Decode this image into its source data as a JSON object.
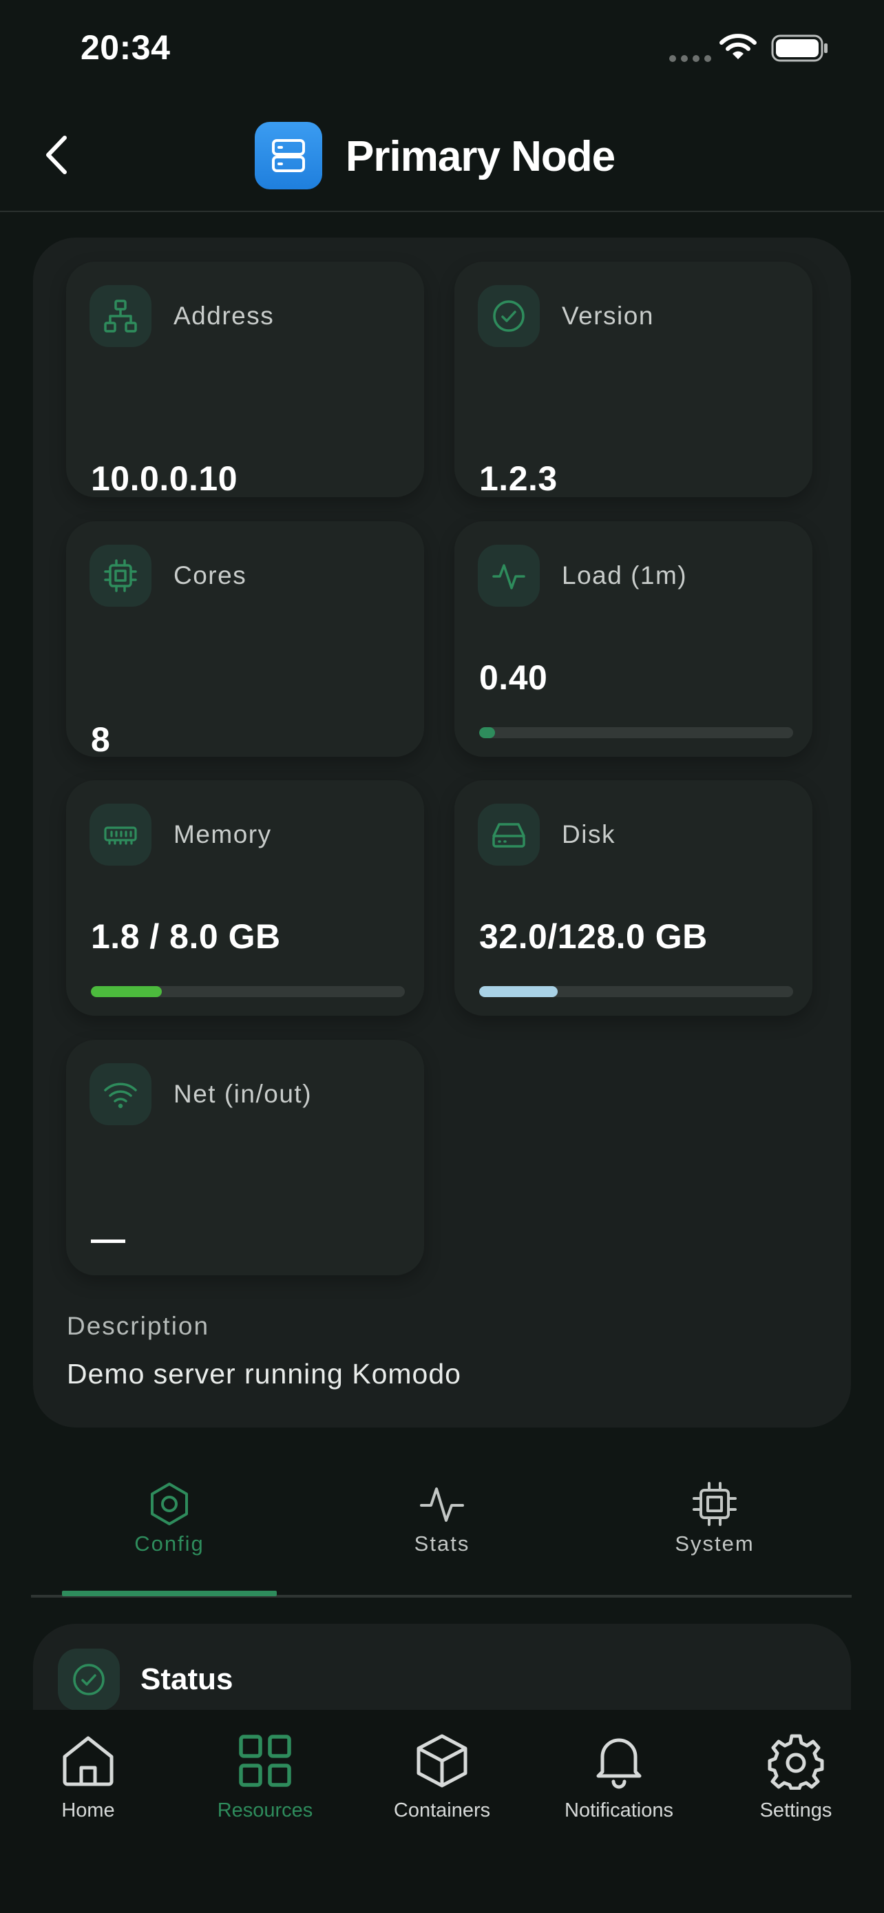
{
  "status_bar": {
    "time": "20:34"
  },
  "header": {
    "title": "Primary Node",
    "icon": "server-icon"
  },
  "tiles": {
    "address": {
      "label": "Address",
      "value": "10.0.0.10",
      "icon": "network-icon"
    },
    "version": {
      "label": "Version",
      "value": "1.2.3",
      "icon": "check-circle-icon"
    },
    "cores": {
      "label": "Cores",
      "value": "8",
      "icon": "cpu-icon"
    },
    "load": {
      "label": "Load (1m)",
      "value": "0.40",
      "icon": "activity-icon",
      "bar_fraction": 0.05,
      "bar_color": "#2e8c5c"
    },
    "memory": {
      "label": "Memory",
      "value": "1.8 / 8.0 GB",
      "icon": "memory-icon",
      "bar_fraction": 0.225,
      "bar_color": "#4cbb3d"
    },
    "disk": {
      "label": "Disk",
      "value": "32.0/128.0 GB",
      "icon": "hard-drive-icon",
      "bar_fraction": 0.25,
      "bar_color": "#a9d2e6"
    },
    "net": {
      "label": "Net (in/out)",
      "value": "—",
      "icon": "wifi-icon"
    }
  },
  "description": {
    "label": "Description",
    "text": "Demo server running Komodo"
  },
  "segments": [
    {
      "label": "Config",
      "icon": "hexagon-icon",
      "active": true
    },
    {
      "label": "Stats",
      "icon": "activity-icon",
      "active": false
    },
    {
      "label": "System",
      "icon": "cpu-icon",
      "active": false
    }
  ],
  "status_section": {
    "title": "Status",
    "icon": "check-circle-icon"
  },
  "tab_bar": [
    {
      "label": "Home",
      "icon": "home-icon",
      "active": false
    },
    {
      "label": "Resources",
      "icon": "grid-icon",
      "active": true
    },
    {
      "label": "Containers",
      "icon": "box-icon",
      "active": false
    },
    {
      "label": "Notifications",
      "icon": "bell-icon",
      "active": false
    },
    {
      "label": "Settings",
      "icon": "gear-icon",
      "active": false
    }
  ],
  "colors": {
    "accent": "#2e8c5c",
    "background": "#101614",
    "card": "#1b201f",
    "tile": "#1f2523"
  }
}
